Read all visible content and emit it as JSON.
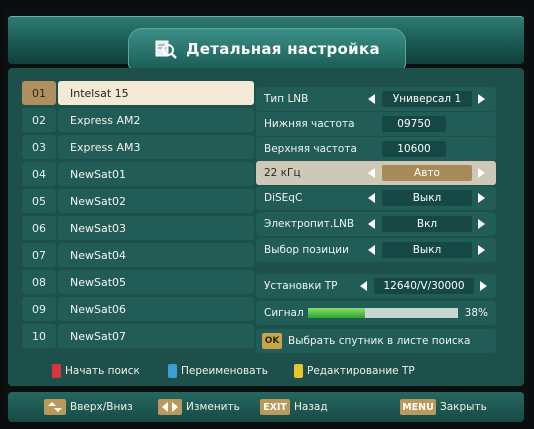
{
  "title": {
    "text": "Детальная настройка",
    "icon": "magnifier-document-icon"
  },
  "satellites": [
    {
      "num": "01",
      "name": "Intelsat 15"
    },
    {
      "num": "02",
      "name": "Express AM2"
    },
    {
      "num": "03",
      "name": "Express AM3"
    },
    {
      "num": "04",
      "name": "NewSat01"
    },
    {
      "num": "05",
      "name": "NewSat02"
    },
    {
      "num": "06",
      "name": "NewSat03"
    },
    {
      "num": "07",
      "name": "NewSat04"
    },
    {
      "num": "08",
      "name": "NewSat05"
    },
    {
      "num": "09",
      "name": "NewSat06"
    },
    {
      "num": "10",
      "name": "NewSat07"
    }
  ],
  "selected_satellite_index": 0,
  "settings": {
    "lnb_type": {
      "label": "Тип LNB",
      "value": "Универсал 1"
    },
    "low_freq": {
      "label": "Нижняя частота",
      "value": "09750"
    },
    "high_freq": {
      "label": "Верхняя частота",
      "value": "10600"
    },
    "tone22": {
      "label": "22 кГц",
      "value": "Авто"
    },
    "diseqc": {
      "label": "DiSEqC",
      "value": "Выкл"
    },
    "lnb_power": {
      "label": "Электропит.LNB",
      "value": "Вкл"
    },
    "position": {
      "label": "Выбор позиции",
      "value": "Выкл"
    },
    "tp": {
      "label": "Установки TP",
      "value": "12640/V/30000"
    },
    "signal": {
      "label": "Сигнал",
      "percent_text": "38%",
      "level": 0.38
    },
    "ok_hint": {
      "badge": "OK",
      "text": "Выбрать спутник в листе поиска"
    }
  },
  "color_hints": {
    "red": {
      "text": "Начать поиск",
      "color": "#d8343a"
    },
    "blue": {
      "text": "Переименовать",
      "color": "#3a9ed8"
    },
    "yellow": {
      "text": "Редактирование TP",
      "color": "#e8c52a"
    }
  },
  "footer": {
    "nav_text": "Вверх/Вниз",
    "change_text": "Изменить",
    "exit_badge": "EXIT",
    "exit_text": "Назад",
    "menu_badge": "MENU",
    "menu_text": "Закрыть"
  },
  "colors": {
    "panel": "#225c57",
    "selected_row": "#f3e9d4",
    "selected_accent": "#b08f5e",
    "signal_fill": "#2aa62e"
  }
}
